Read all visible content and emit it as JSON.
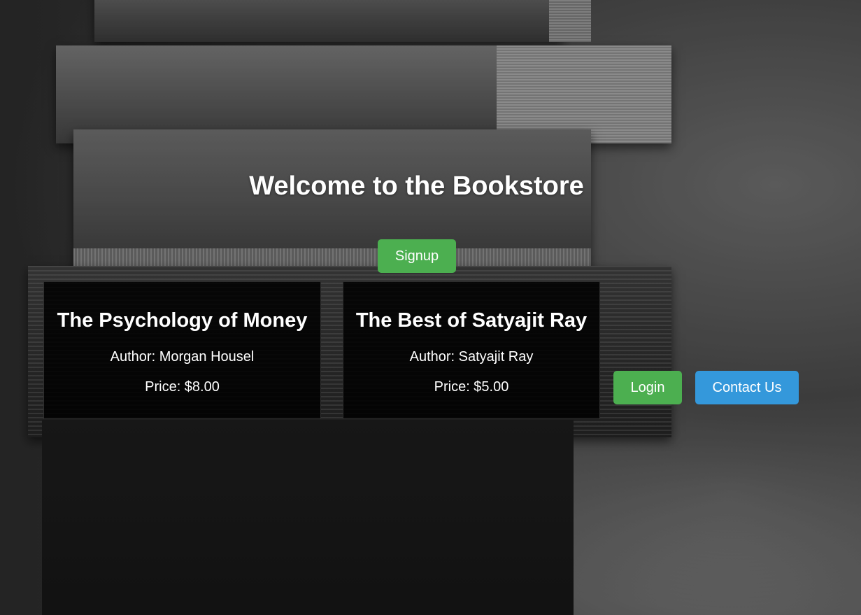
{
  "page": {
    "title": "Welcome to the Bookstore"
  },
  "buttons": {
    "signup": "Signup",
    "login": "Login",
    "contact": "Contact Us"
  },
  "books": [
    {
      "title": "The Psychology of Money",
      "author": "Author: Morgan Housel",
      "price": "Price: $8.00"
    },
    {
      "title": "The Best of Satyajit Ray",
      "author": "Author: Satyajit Ray",
      "price": "Price: $5.00"
    }
  ],
  "colors": {
    "signup_login": "#4caf50",
    "contact": "#3498db",
    "card_bg": "#000000",
    "text": "#ffffff"
  }
}
